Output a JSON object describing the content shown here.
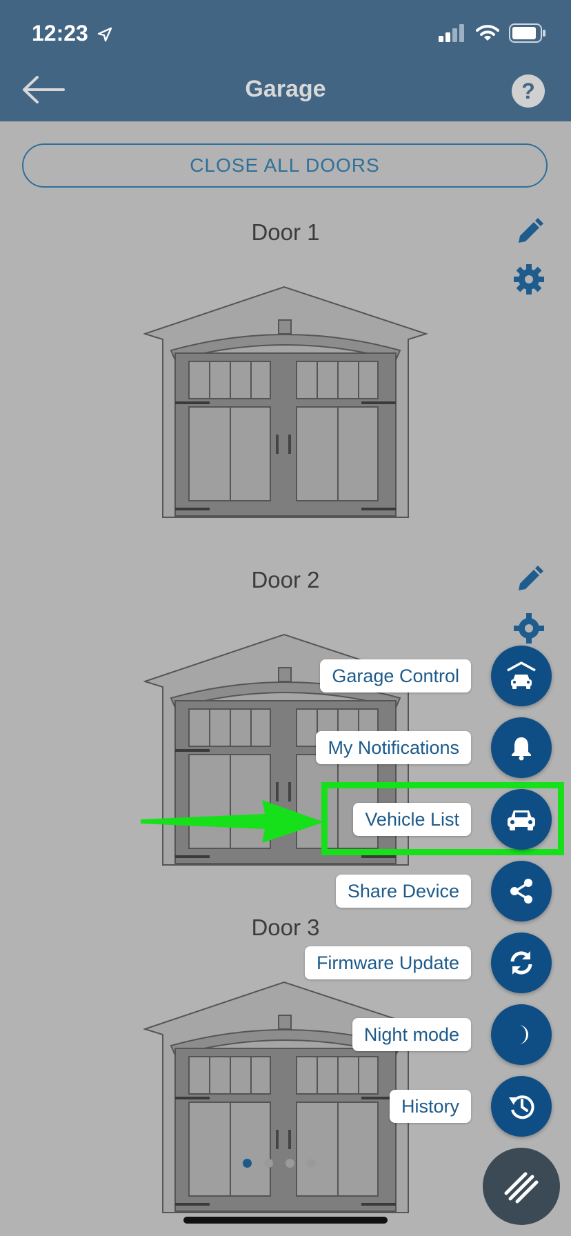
{
  "status": {
    "time": "12:23"
  },
  "header": {
    "title": "Garage"
  },
  "actions": {
    "close_all": "CLOSE ALL DOORS"
  },
  "doors": [
    {
      "name": "Door 1"
    },
    {
      "name": "Door 2"
    },
    {
      "name": "Door 3"
    }
  ],
  "fab_menu": {
    "items": [
      {
        "label": "Garage Control",
        "icon": "garage-car-icon"
      },
      {
        "label": "My Notifications",
        "icon": "bell-icon"
      },
      {
        "label": "Vehicle List",
        "icon": "car-icon"
      },
      {
        "label": "Share Device",
        "icon": "share-icon"
      },
      {
        "label": "Firmware Update",
        "icon": "refresh-icon"
      },
      {
        "label": "Night mode",
        "icon": "moon-icon"
      },
      {
        "label": "History",
        "icon": "history-icon"
      }
    ]
  },
  "pager": {
    "current": 1,
    "total": 4
  },
  "colors": {
    "header": "#436584",
    "accent": "#0e4e85",
    "highlight": "#15e01a"
  }
}
